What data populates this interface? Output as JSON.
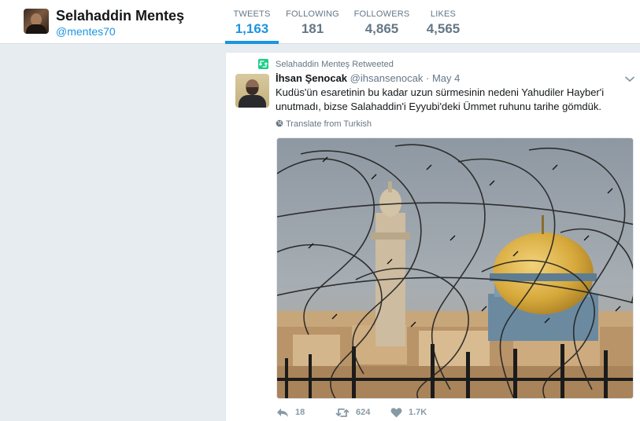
{
  "profile": {
    "name": "Selahaddin Menteş",
    "handle": "@mentes70"
  },
  "stats": [
    {
      "label": "TWEETS",
      "value": "1,163",
      "active": true
    },
    {
      "label": "FOLLOWING",
      "value": "181",
      "active": false
    },
    {
      "label": "FOLLOWERS",
      "value": "4,865",
      "active": false
    },
    {
      "label": "LIKES",
      "value": "4,565",
      "active": false
    }
  ],
  "tweet": {
    "retweet_context": "Selahaddin Menteş Retweeted",
    "author_name": "İhsan Şenocak",
    "author_handle": "@ihsansenocak",
    "separator": "·",
    "date": "May 4",
    "text": "Kudüs'ün esaretinin bu kadar uzun sürmesinin nedeni Yahudiler Hayber'i unutmadı, bizse Salahaddin'i Eyyubi'deki Ümmet ruhunu tarihe gömdük.",
    "translate_label": "Translate from Turkish",
    "actions": {
      "reply_count": "18",
      "retweet_count": "624",
      "like_count": "1.7K"
    },
    "icons": [
      "retweet-icon",
      "chevron-down-icon",
      "globe-icon",
      "reply-icon",
      "retweet-icon",
      "heart-icon"
    ]
  },
  "colors": {
    "accent": "#1b95e0",
    "retweet_green": "#19cf86",
    "muted": "#657786",
    "background": "#e6ecf0"
  }
}
